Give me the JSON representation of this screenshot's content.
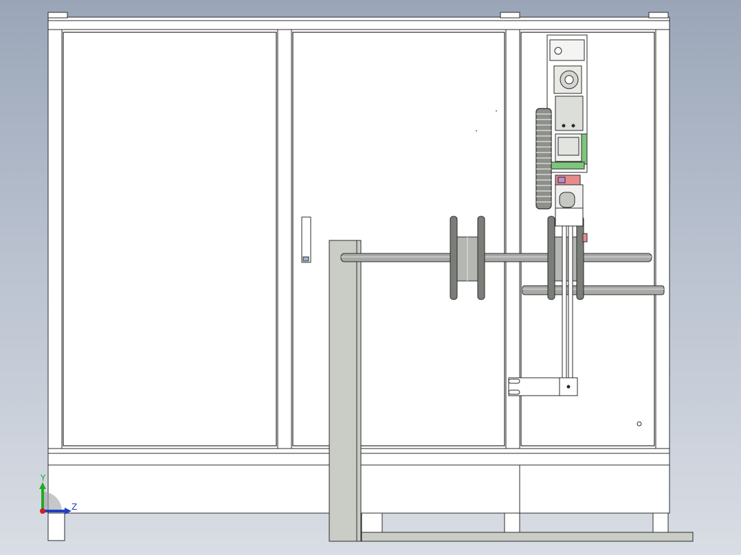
{
  "view": {
    "background_top": "#9aa6b8",
    "background_bottom": "#d9dde4"
  },
  "colors": {
    "line": "#2a2a2a",
    "panel": "#ffffff",
    "leg": "#c9cdc5",
    "shaft": "#a7aaa6",
    "reel": "#7a7d78",
    "accent_green": "#7dc67d",
    "accent_pink": "#e58b8b",
    "accent_purple": "#b88fd6",
    "axis_y": "#22aa22",
    "axis_x": "#1f3fbf",
    "axis_origin": "#cc2222"
  },
  "triad": {
    "y_label": "Y",
    "x_label": "Z",
    "icon": "coordinate-triad-icon"
  }
}
